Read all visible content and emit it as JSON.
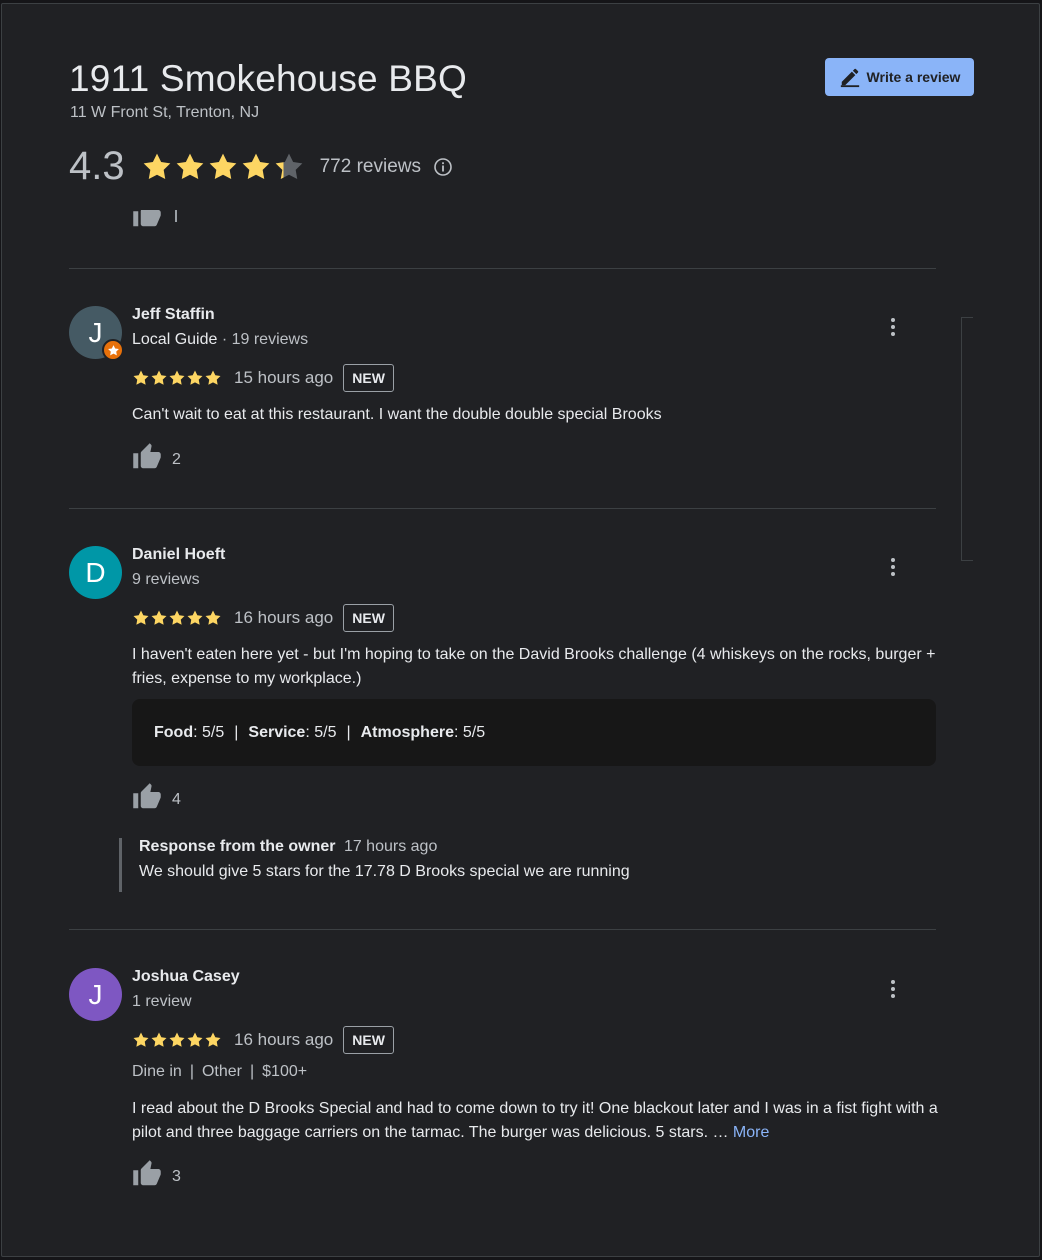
{
  "place": {
    "name": "1911 Smokehouse BBQ",
    "address": "11 W Front St, Trenton, NJ",
    "rating": "4.3",
    "rating_value": 4.3,
    "review_count": "772 reviews"
  },
  "actions": {
    "write_review": "Write a review"
  },
  "colors": {
    "star": "#fdd663",
    "star_empty": "#5f6368",
    "accent": "#8ab4f8"
  },
  "reviews": [
    {
      "name": "Jeff Staffin",
      "initial": "J",
      "avatar_color": "#455a64",
      "local_guide": true,
      "guide_label": "Local Guide",
      "meta": "19 reviews",
      "stars": 5,
      "time": "15 hours ago",
      "badge": "NEW",
      "text": "Can't wait to eat at this restaurant. I want the double double special Brooks",
      "likes": "2"
    },
    {
      "name": "Daniel Hoeft",
      "initial": "D",
      "avatar_color": "#0097a7",
      "meta": "9 reviews",
      "stars": 5,
      "time": "16 hours ago",
      "badge": "NEW",
      "text": "I haven't eaten here yet - but I'm hoping to take on the David Brooks challenge (4 whiskeys on the rocks, burger + fries, expense to my workplace.)",
      "attributes": {
        "food_label": "Food",
        "food_value": ": 5/5",
        "service_label": "Service",
        "service_value": ": 5/5",
        "atmosphere_label": "Atmosphere",
        "atmosphere_value": ": 5/5"
      },
      "likes": "4",
      "owner_response": {
        "title": "Response from the owner",
        "time": "17 hours ago",
        "text": "We should give 5 stars for the 17.78 D Brooks special we are running"
      }
    },
    {
      "name": "Joshua Casey",
      "initial": "J",
      "avatar_color": "#7e57c2",
      "meta": "1 review",
      "stars": 5,
      "time": "16 hours ago",
      "badge": "NEW",
      "tags": [
        "Dine in",
        "Other",
        "$100+"
      ],
      "text": "I read about the D Brooks Special and had to come down to try it! One blackout later and I was in a fist fight with a pilot and three baggage carriers on the tarmac. The burger was delicious. 5 stars. … ",
      "more_label": "More",
      "likes": "3"
    }
  ]
}
